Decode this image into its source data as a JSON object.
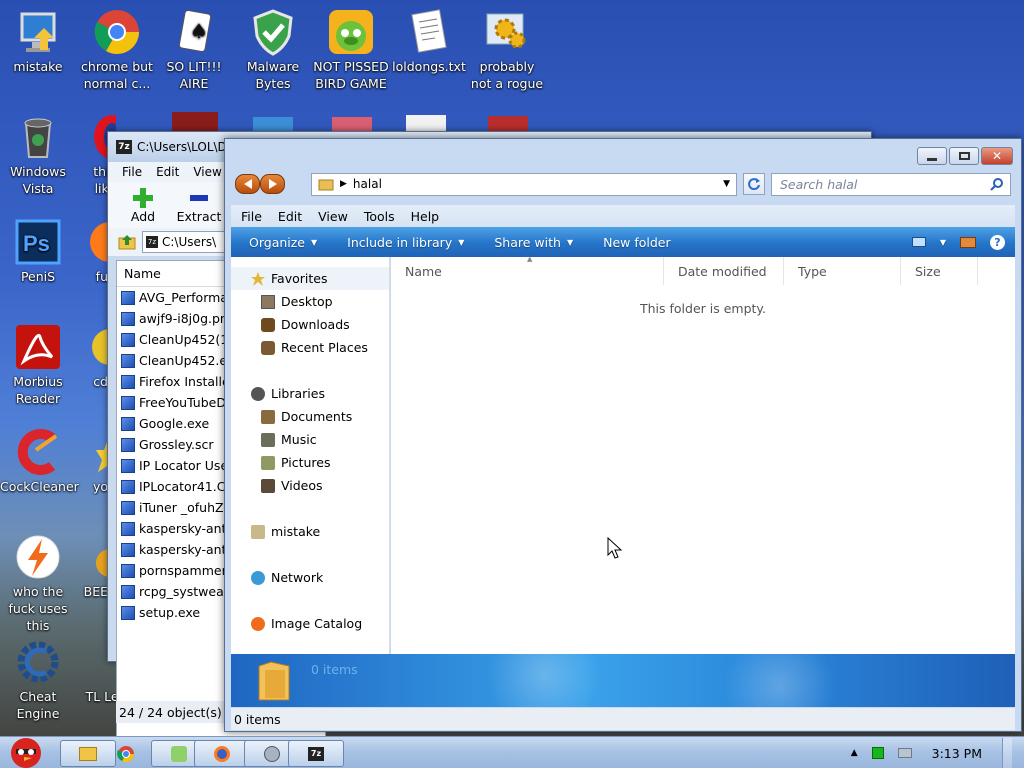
{
  "desktop": {
    "icons": [
      {
        "label": "mistake",
        "icon": "computer-icon"
      },
      {
        "label": "chrome but normal c...",
        "icon": "chrome-icon"
      },
      {
        "label": "SO LIT!!! AIRE",
        "icon": "solitaire-icon"
      },
      {
        "label": "Malware Bytes",
        "icon": "shield-icon"
      },
      {
        "label": "NOT PISSED BIRD GAME",
        "icon": "bird-game-icon"
      },
      {
        "label": "loldongs.txt",
        "icon": "text-file-icon"
      },
      {
        "label": "probably not a rogue",
        "icon": "gears-icon"
      },
      {
        "label": "Windows Vista",
        "icon": "recycle-bin-icon"
      },
      {
        "label": "this like",
        "icon": "opera-icon"
      },
      {
        "label": "PeniS",
        "icon": "photoshop-icon"
      },
      {
        "label": "fu",
        "icon": "firefox-icon"
      },
      {
        "label": "Morbius Reader",
        "icon": "pdf-reader-icon"
      },
      {
        "label": "cd",
        "icon": "cd-icon"
      },
      {
        "label": "CockCleaner",
        "icon": "ccleaner-icon"
      },
      {
        "label": "yo",
        "icon": "star-icon"
      },
      {
        "label": "who the fuck uses this",
        "icon": "lightning-icon"
      },
      {
        "label": "BEE",
        "icon": "bee-icon"
      },
      {
        "label": "Cheat Engine",
        "icon": "cheat-engine-icon"
      },
      {
        "label": "TL Legacy",
        "icon": "launcher-icon"
      }
    ]
  },
  "zip_window": {
    "title": "C:\\Users\\LOL\\D",
    "menu": [
      "File",
      "Edit",
      "View"
    ],
    "toolbar": {
      "add": "Add",
      "extract": "Extract",
      "test": "T"
    },
    "address": "C:\\Users\\",
    "column_name": "Name",
    "files": [
      "AVG_Performa",
      "awjf9-i8j0g.png",
      "CleanUp452(1)",
      "CleanUp452.ex",
      "Firefox Installe",
      "FreeYouTubeD",
      "Google.exe",
      "Grossley.scr",
      "IP Locator Use",
      "IPLocator41.CA",
      "iTuner _ofuhZ.e",
      "kaspersky-anti",
      "kaspersky-anti",
      "pornspammer.",
      "rcpg_systweak",
      "setup.exe"
    ],
    "status": "24 / 24 object(s) se"
  },
  "explorer": {
    "breadcrumb": "halal",
    "search_placeholder": "Search halal",
    "menu": [
      "File",
      "Edit",
      "View",
      "Tools",
      "Help"
    ],
    "commands": {
      "organize": "Organize",
      "include": "Include in library",
      "share": "Share with",
      "new_folder": "New folder"
    },
    "nav": {
      "favorites": "Favorites",
      "favorites_items": [
        "Desktop",
        "Downloads",
        "Recent Places"
      ],
      "libraries": "Libraries",
      "libraries_items": [
        "Documents",
        "Music",
        "Pictures",
        "Videos"
      ],
      "homegroup": "mistake",
      "network": "Network",
      "image_catalog": "Image Catalog"
    },
    "columns": [
      "Name",
      "Date modified",
      "Type",
      "Size"
    ],
    "empty_message": "This folder is empty.",
    "details_count": "0 items",
    "status_count": "0 items"
  },
  "taskbar": {
    "clock": "3:13 PM",
    "items": [
      "explorer",
      "chrome",
      "recycle",
      "firefox",
      "app",
      "7zip"
    ]
  },
  "colors": {
    "command_bar": "#2574c9",
    "nav_button": "#d8671f",
    "close_button": "#c4402b"
  }
}
